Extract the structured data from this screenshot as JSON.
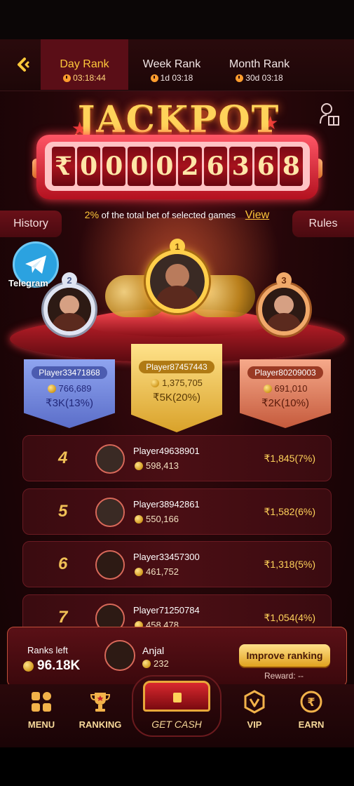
{
  "tabs": [
    {
      "label": "Day Rank",
      "time": "03:18:44",
      "active": true
    },
    {
      "label": "Week Rank",
      "time": "1d 03:18",
      "active": false
    },
    {
      "label": "Month Rank",
      "time": "30d 03:18",
      "active": false
    }
  ],
  "jackpot": {
    "title": "JACKPOT",
    "currency": "₹",
    "digits": [
      "0",
      "0",
      "0",
      "0",
      "2",
      "6",
      "3",
      "6",
      "8"
    ],
    "note_pct": "2%",
    "note_text": "of the total bet of selected games",
    "view_label": "View"
  },
  "side_buttons": {
    "history": "History",
    "rules": "Rules"
  },
  "telegram_label": "Telegram",
  "podium": [
    {
      "rank": "1",
      "name": "Player87457443",
      "score": "1,375,705",
      "prize": "₹5K(20%)"
    },
    {
      "rank": "2",
      "name": "Player33471868",
      "score": "766,689",
      "prize": "₹3K(13%)"
    },
    {
      "rank": "3",
      "name": "Player80209003",
      "score": "691,010",
      "prize": "₹2K(10%)"
    }
  ],
  "rows": [
    {
      "rank": "4",
      "name": "Player49638901",
      "score": "598,413",
      "prize": "₹1,845(7%)"
    },
    {
      "rank": "5",
      "name": "Player38942861",
      "score": "550,166",
      "prize": "₹1,582(6%)"
    },
    {
      "rank": "6",
      "name": "Player33457300",
      "score": "461,752",
      "prize": "₹1,318(5%)"
    },
    {
      "rank": "7",
      "name": "Player71250784",
      "score": "458,478",
      "prize": "₹1,054(4%)"
    }
  ],
  "me": {
    "ranks_left_label": "Ranks left",
    "ranks_left_value": "96.18K",
    "name": "Anjal",
    "score": "232",
    "improve_label": "Improve ranking",
    "reward_label": "Reward: --"
  },
  "nav": {
    "menu": "MENU",
    "ranking": "RANKING",
    "get_cash": "GET CASH",
    "vip": "VIP",
    "earn": "EARN"
  }
}
